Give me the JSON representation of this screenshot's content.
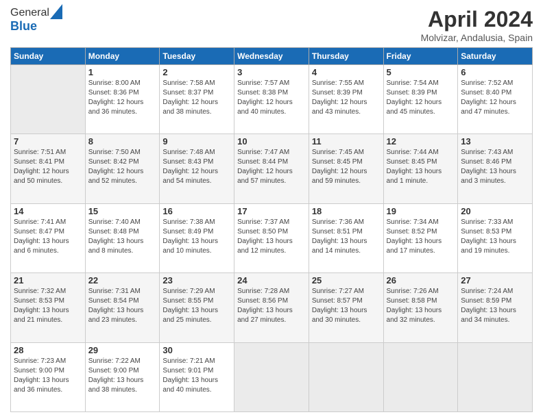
{
  "header": {
    "logo_general": "General",
    "logo_blue": "Blue",
    "month": "April 2024",
    "location": "Molvizar, Andalusia, Spain"
  },
  "weekdays": [
    "Sunday",
    "Monday",
    "Tuesday",
    "Wednesday",
    "Thursday",
    "Friday",
    "Saturday"
  ],
  "weeks": [
    [
      {
        "day": "",
        "info": ""
      },
      {
        "day": "1",
        "info": "Sunrise: 8:00 AM\nSunset: 8:36 PM\nDaylight: 12 hours\nand 36 minutes."
      },
      {
        "day": "2",
        "info": "Sunrise: 7:58 AM\nSunset: 8:37 PM\nDaylight: 12 hours\nand 38 minutes."
      },
      {
        "day": "3",
        "info": "Sunrise: 7:57 AM\nSunset: 8:38 PM\nDaylight: 12 hours\nand 40 minutes."
      },
      {
        "day": "4",
        "info": "Sunrise: 7:55 AM\nSunset: 8:39 PM\nDaylight: 12 hours\nand 43 minutes."
      },
      {
        "day": "5",
        "info": "Sunrise: 7:54 AM\nSunset: 8:39 PM\nDaylight: 12 hours\nand 45 minutes."
      },
      {
        "day": "6",
        "info": "Sunrise: 7:52 AM\nSunset: 8:40 PM\nDaylight: 12 hours\nand 47 minutes."
      }
    ],
    [
      {
        "day": "7",
        "info": "Sunrise: 7:51 AM\nSunset: 8:41 PM\nDaylight: 12 hours\nand 50 minutes."
      },
      {
        "day": "8",
        "info": "Sunrise: 7:50 AM\nSunset: 8:42 PM\nDaylight: 12 hours\nand 52 minutes."
      },
      {
        "day": "9",
        "info": "Sunrise: 7:48 AM\nSunset: 8:43 PM\nDaylight: 12 hours\nand 54 minutes."
      },
      {
        "day": "10",
        "info": "Sunrise: 7:47 AM\nSunset: 8:44 PM\nDaylight: 12 hours\nand 57 minutes."
      },
      {
        "day": "11",
        "info": "Sunrise: 7:45 AM\nSunset: 8:45 PM\nDaylight: 12 hours\nand 59 minutes."
      },
      {
        "day": "12",
        "info": "Sunrise: 7:44 AM\nSunset: 8:45 PM\nDaylight: 13 hours\nand 1 minute."
      },
      {
        "day": "13",
        "info": "Sunrise: 7:43 AM\nSunset: 8:46 PM\nDaylight: 13 hours\nand 3 minutes."
      }
    ],
    [
      {
        "day": "14",
        "info": "Sunrise: 7:41 AM\nSunset: 8:47 PM\nDaylight: 13 hours\nand 6 minutes."
      },
      {
        "day": "15",
        "info": "Sunrise: 7:40 AM\nSunset: 8:48 PM\nDaylight: 13 hours\nand 8 minutes."
      },
      {
        "day": "16",
        "info": "Sunrise: 7:38 AM\nSunset: 8:49 PM\nDaylight: 13 hours\nand 10 minutes."
      },
      {
        "day": "17",
        "info": "Sunrise: 7:37 AM\nSunset: 8:50 PM\nDaylight: 13 hours\nand 12 minutes."
      },
      {
        "day": "18",
        "info": "Sunrise: 7:36 AM\nSunset: 8:51 PM\nDaylight: 13 hours\nand 14 minutes."
      },
      {
        "day": "19",
        "info": "Sunrise: 7:34 AM\nSunset: 8:52 PM\nDaylight: 13 hours\nand 17 minutes."
      },
      {
        "day": "20",
        "info": "Sunrise: 7:33 AM\nSunset: 8:53 PM\nDaylight: 13 hours\nand 19 minutes."
      }
    ],
    [
      {
        "day": "21",
        "info": "Sunrise: 7:32 AM\nSunset: 8:53 PM\nDaylight: 13 hours\nand 21 minutes."
      },
      {
        "day": "22",
        "info": "Sunrise: 7:31 AM\nSunset: 8:54 PM\nDaylight: 13 hours\nand 23 minutes."
      },
      {
        "day": "23",
        "info": "Sunrise: 7:29 AM\nSunset: 8:55 PM\nDaylight: 13 hours\nand 25 minutes."
      },
      {
        "day": "24",
        "info": "Sunrise: 7:28 AM\nSunset: 8:56 PM\nDaylight: 13 hours\nand 27 minutes."
      },
      {
        "day": "25",
        "info": "Sunrise: 7:27 AM\nSunset: 8:57 PM\nDaylight: 13 hours\nand 30 minutes."
      },
      {
        "day": "26",
        "info": "Sunrise: 7:26 AM\nSunset: 8:58 PM\nDaylight: 13 hours\nand 32 minutes."
      },
      {
        "day": "27",
        "info": "Sunrise: 7:24 AM\nSunset: 8:59 PM\nDaylight: 13 hours\nand 34 minutes."
      }
    ],
    [
      {
        "day": "28",
        "info": "Sunrise: 7:23 AM\nSunset: 9:00 PM\nDaylight: 13 hours\nand 36 minutes."
      },
      {
        "day": "29",
        "info": "Sunrise: 7:22 AM\nSunset: 9:00 PM\nDaylight: 13 hours\nand 38 minutes."
      },
      {
        "day": "30",
        "info": "Sunrise: 7:21 AM\nSunset: 9:01 PM\nDaylight: 13 hours\nand 40 minutes."
      },
      {
        "day": "",
        "info": ""
      },
      {
        "day": "",
        "info": ""
      },
      {
        "day": "",
        "info": ""
      },
      {
        "day": "",
        "info": ""
      }
    ]
  ]
}
